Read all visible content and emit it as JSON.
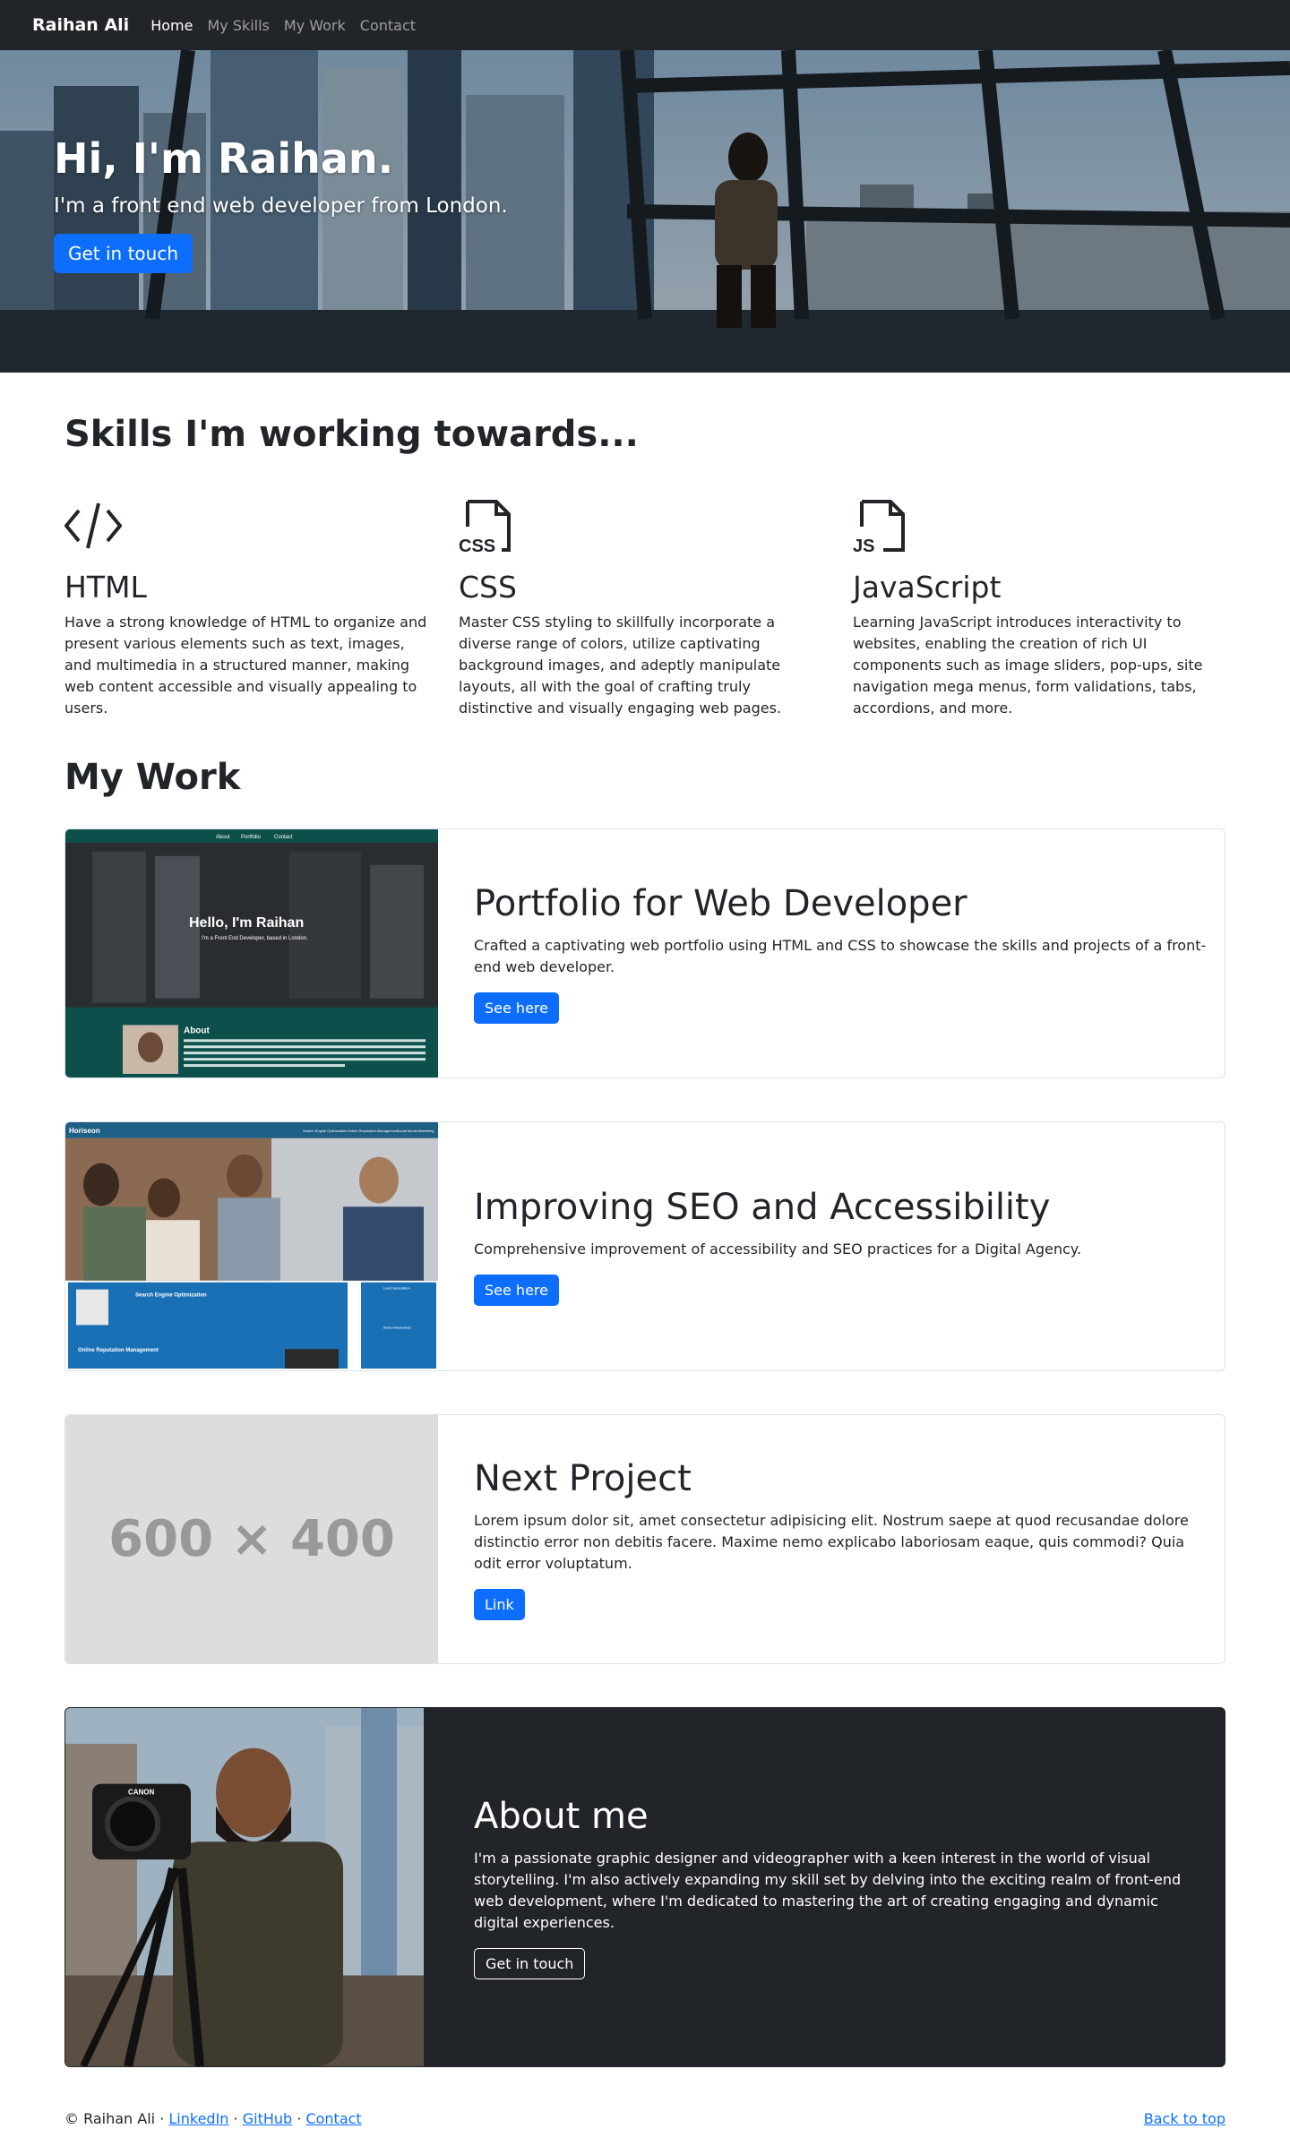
{
  "nav": {
    "brand": "Raihan Ali",
    "items": [
      {
        "label": "Home",
        "active": true
      },
      {
        "label": "My Skills"
      },
      {
        "label": "My Work"
      },
      {
        "label": "Contact"
      }
    ]
  },
  "hero": {
    "title": "Hi, I'm Raihan.",
    "subtitle": "I'm a front end web developer from London.",
    "cta": "Get in touch"
  },
  "skills": {
    "title": "Skills I'm working towards...",
    "items": [
      {
        "name": "HTML",
        "icon": "code-slash-icon",
        "desc": "Have a strong knowledge of HTML to organize and present various elements such as text, images, and multimedia in a structured manner, making web content accessible and visually appealing to users."
      },
      {
        "name": "CSS",
        "icon": "file-css-icon",
        "icon_text": "CSS",
        "desc": "Master CSS styling to skillfully incorporate a diverse range of colors, utilize captivating background images, and adeptly manipulate layouts, all with the goal of crafting truly distinctive and visually engaging web pages."
      },
      {
        "name": "JavaScript",
        "icon": "file-js-icon",
        "icon_text": "JS",
        "desc": "Learning JavaScript introduces interactivity to websites, enabling the creation of rich UI components such as image sliders, pop-ups, site navigation mega menus, form validations, tabs, accordions, and more."
      }
    ]
  },
  "work": {
    "title": "My Work",
    "cards": [
      {
        "title": "Portfolio for Web Developer",
        "text": "Crafted a captivating web portfolio using HTML and CSS to showcase the skills and projects of a front-end web developer.",
        "button": "See here",
        "thumb": {
          "nav": [
            "About",
            "Portfolio",
            "Contact"
          ],
          "heading": "Hello, I'm Raihan",
          "sub": "I'm a Front End Developer, based in London.",
          "about": "About"
        }
      },
      {
        "title": "Improving SEO and Accessibility",
        "text": "Comprehensive improvement of accessibility and SEO practices for a Digital Agency.",
        "button": "See here",
        "thumb": {
          "brand": "Horiseon",
          "nav": [
            "Search Engine Optimization",
            "Online Reputation Management",
            "Social Media Marketing"
          ],
          "heading1": "Search Engine Optimization",
          "heading2": "Online Reputation Management",
          "side1": "Lead Generation",
          "side2": "Brand Awareness"
        }
      },
      {
        "title": "Next Project",
        "text": "Lorem ipsum dolor sit, amet consectetur adipisicing elit. Nostrum saepe at quod recusandae dolore distinctio error non debitis facere. Maxime nemo explicabo laboriosam eaque, quis commodi? Quia odit error voluptatum.",
        "button": "Link",
        "placeholder": "600 × 400"
      }
    ]
  },
  "about": {
    "title": "About me",
    "text": "I'm a passionate graphic designer and videographer with a keen interest in the world of visual storytelling. I'm also actively expanding my skill set by delving into the exciting realm of front-end web development, where I'm dedicated to mastering the art of creating engaging and dynamic digital experiences.",
    "button": "Get in touch",
    "camera_brand": "CANON"
  },
  "footer": {
    "copyright": "© Raihan Ali ·",
    "links": [
      "LinkedIn",
      "GitHub",
      "Contact"
    ],
    "separator": "·",
    "back_to_top": "Back to top"
  },
  "colors": {
    "primary": "#0d6efd",
    "dark": "#212529",
    "border": "#dee2e6",
    "placeholder": "#dddddd"
  }
}
